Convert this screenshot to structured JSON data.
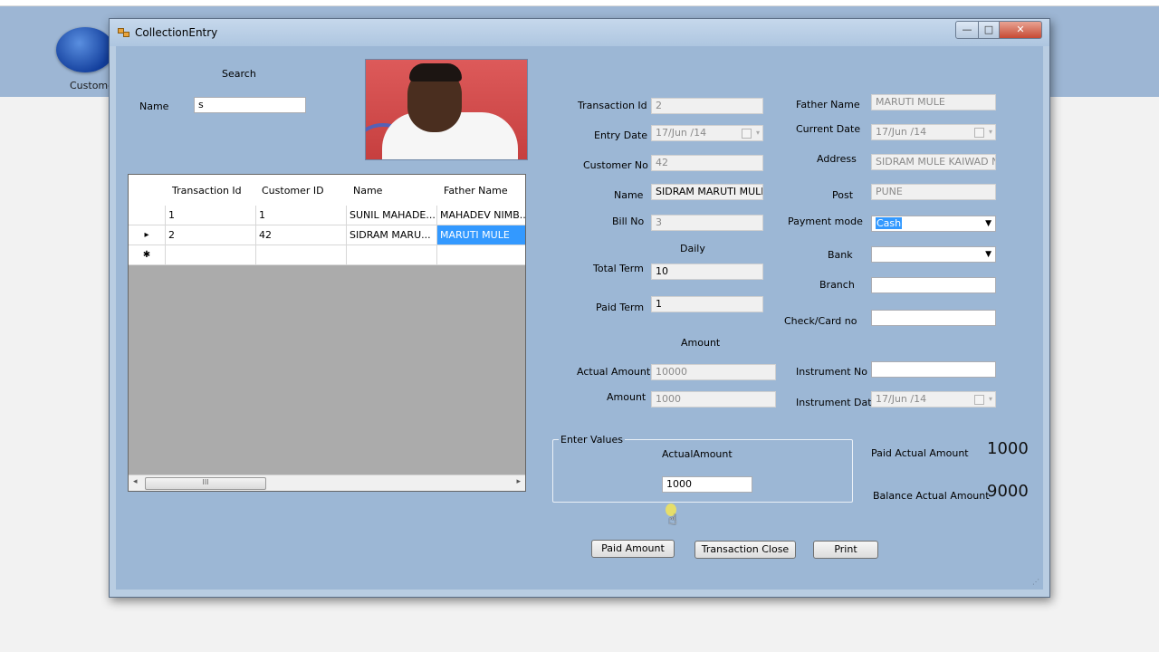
{
  "background": {
    "app_label": "Customer"
  },
  "window": {
    "title": "CollectionEntry",
    "controls": {
      "minimize": "—",
      "maximize": "□",
      "close": "✕"
    }
  },
  "search": {
    "heading": "Search",
    "name_label": "Name",
    "name_value": "s"
  },
  "grid": {
    "columns": [
      "Transaction Id",
      "Customer ID",
      "Name",
      "Father Name"
    ],
    "rows": [
      {
        "marker": "",
        "cells": [
          "1",
          "1",
          "SUNIL MAHADE...",
          "MAHADEV NIMB..."
        ]
      },
      {
        "marker": "▸",
        "cells": [
          "2",
          "42",
          "SIDRAM MARU...",
          "MARUTI MULE"
        ]
      },
      {
        "marker": "✱",
        "cells": [
          "",
          "",
          "",
          ""
        ]
      }
    ],
    "scroll_thumb": "III"
  },
  "form": {
    "transaction_id": {
      "label": "Transaction Id",
      "value": "2"
    },
    "entry_date": {
      "label": "Entry Date",
      "value": "17/Jun /14"
    },
    "customer_no": {
      "label": "Customer No",
      "value": "42"
    },
    "name": {
      "label": "Name",
      "value": "SIDRAM MARUTI MULE"
    },
    "bill_no": {
      "label": "Bill No",
      "value": "3"
    },
    "daily_heading": "Daily",
    "total_term": {
      "label": "Total Term",
      "value": "10"
    },
    "paid_term": {
      "label": "Paid Term",
      "value": "1"
    },
    "amount_heading": "Amount",
    "actual_amount": {
      "label": "Actual Amount",
      "value": "10000"
    },
    "amount": {
      "label": "Amount",
      "value": "1000"
    },
    "father_name": {
      "label": "Father Name",
      "value": "MARUTI MULE"
    },
    "current_date": {
      "label": "Current Date",
      "value": "17/Jun /14"
    },
    "address": {
      "label": "Address",
      "value": "SIDRAM MULE  KAIWAD N"
    },
    "post": {
      "label": "Post",
      "value": "PUNE"
    },
    "payment_mode": {
      "label": "Payment mode",
      "value": "Cash"
    },
    "bank": {
      "label": "Bank",
      "value": ""
    },
    "branch": {
      "label": "Branch",
      "value": ""
    },
    "check_card_no": {
      "label": "Check/Card no",
      "value": ""
    },
    "instrument_no": {
      "label": "Instrument No",
      "value": ""
    },
    "instrument_date": {
      "label": "Instrument Date",
      "value": "17/Jun /14"
    }
  },
  "enter_values": {
    "title": "Enter Values",
    "actual_amount_label": "ActualAmount",
    "actual_amount_value": "1000"
  },
  "summary": {
    "paid_actual_amount_label": "Paid Actual Amount",
    "paid_actual_amount_value": "1000",
    "balance_actual_amount_label": "Balance Actual Amount",
    "balance_actual_amount_value": "9000"
  },
  "buttons": {
    "paid_amount": "Paid Amount",
    "transaction_close": "Transaction Close",
    "print": "Print"
  },
  "colors": {
    "window_client": "#9cb7d5",
    "selection": "#3399ff"
  }
}
